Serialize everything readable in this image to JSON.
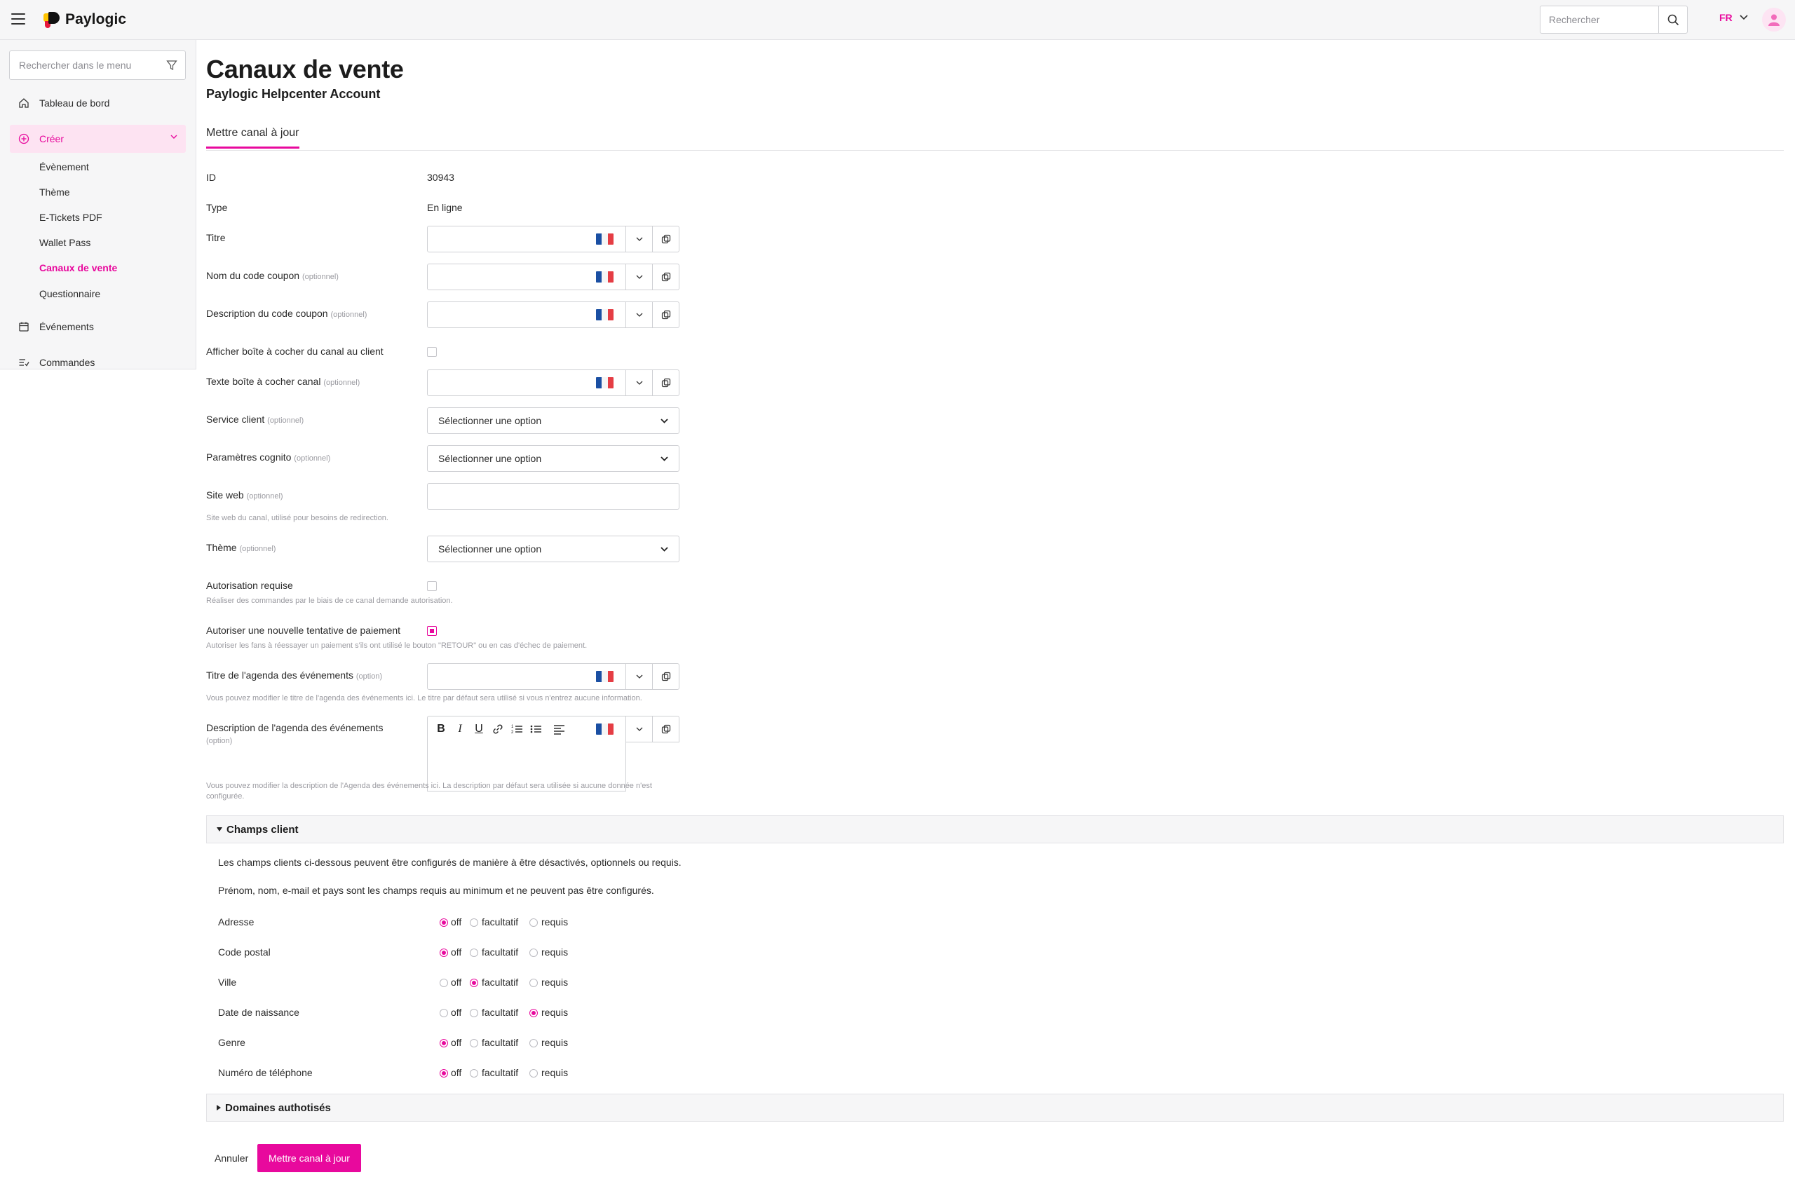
{
  "app": {
    "brand": "Paylogic",
    "search_placeholder": "Rechercher",
    "language": "FR"
  },
  "sidebar": {
    "search_placeholder": "Rechercher dans le menu",
    "items": [
      {
        "label": "Tableau de bord",
        "icon": "home-icon"
      },
      {
        "label": "Créer",
        "icon": "plus-circle-icon",
        "active": true
      },
      {
        "label": "Événements",
        "icon": "calendar-icon"
      },
      {
        "label": "Commandes",
        "icon": "list-icon"
      }
    ],
    "sub_items": [
      "Évènement",
      "Thème",
      "E-Tickets PDF",
      "Wallet Pass",
      "Canaux de vente",
      "Questionnaire"
    ],
    "active_sub": "Canaux de vente"
  },
  "page": {
    "title": "Canaux de vente",
    "subtitle": "Paylogic Helpcenter Account",
    "tab": "Mettre canal à jour"
  },
  "form": {
    "optional": "(optionnel)",
    "option": "(option)",
    "id_label": "ID",
    "id_value": "30943",
    "type_label": "Type",
    "type_value": "En ligne",
    "title_label": "Titre",
    "coupon_name_label": "Nom du code coupon",
    "coupon_desc_label": "Description du code coupon",
    "show_checkbox_label": "Afficher boîte à cocher du canal au client",
    "checkbox_text_label": "Texte boîte à cocher canal",
    "customer_service_label": "Service client",
    "cognito_label": "Paramètres cognito",
    "website_label": "Site web",
    "website_help": "Site web du canal, utilisé pour besoins de redirection.",
    "theme_label": "Thème",
    "select_placeholder": "Sélectionner une option",
    "auth_label": "Autorisation requise",
    "auth_help": "Réaliser des commandes par le biais de ce canal demande autorisation.",
    "retry_label": "Autoriser une nouvelle tentative de paiement",
    "retry_help": "Autoriser les fans à réessayer un paiement s'ils ont utilisé le bouton \"RETOUR\" ou en cas d'échec de paiement.",
    "agenda_title_label": "Titre de l'agenda des événements",
    "agenda_title_help": "Vous pouvez modifier le titre de l'agenda des événements ici. Le titre par défaut sera utilisé si vous n'entrez aucune information.",
    "agenda_desc_label": "Description de l'agenda des événements",
    "agenda_desc_help_1": "Vous pouvez modifier la description de l'Agenda des événements ici. La description par défaut sera utilisée si aucune donnée n'est",
    "agenda_desc_help_2": "configurée.",
    "show_checkbox_checked": false,
    "auth_checked": false,
    "retry_checked": true
  },
  "customer_fields": {
    "header": "Champs client",
    "intro_1": "Les champs clients ci-dessous peuvent être configurés de manière à être désactivés, optionnels ou requis.",
    "intro_2": "Prénom, nom, e-mail et pays sont les champs requis au minimum et ne peuvent pas être configurés.",
    "option_labels": [
      "off",
      "facultatif",
      "requis"
    ],
    "rows": [
      {
        "label": "Adresse",
        "selected": "off"
      },
      {
        "label": "Code postal",
        "selected": "off"
      },
      {
        "label": "Ville",
        "selected": "facultatif"
      },
      {
        "label": "Date de naissance",
        "selected": "requis"
      },
      {
        "label": "Genre",
        "selected": "off"
      },
      {
        "label": "Numéro de téléphone",
        "selected": "off"
      }
    ]
  },
  "allowed_domains": {
    "header": "Domaines authotisés"
  },
  "actions": {
    "cancel": "Annuler",
    "submit": "Mettre canal à jour"
  },
  "colors": {
    "accent": "#e8099d",
    "accent_light": "#fde3f2"
  }
}
